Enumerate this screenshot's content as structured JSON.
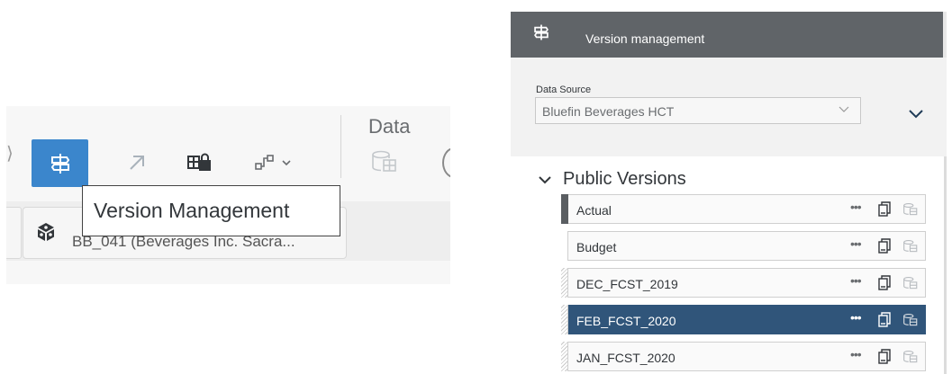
{
  "toolbar": {
    "data_group_label": "Data",
    "buttons": [
      {
        "name": "version-management",
        "icon": "signpost-icon",
        "active": true
      },
      {
        "name": "open-in-new",
        "icon": "arrow-up-right-icon"
      },
      {
        "name": "lock-cells",
        "icon": "table-lock-icon"
      },
      {
        "name": "link-dimensions",
        "icon": "link-icon"
      },
      {
        "name": "data-publish",
        "icon": "database-icon"
      }
    ],
    "tooltip": "Version Management",
    "model_tab": {
      "icon": "cube-icon",
      "label": "BB_041 (Beverages Inc. Sacra..."
    }
  },
  "panel": {
    "title": "Version management",
    "data_source": {
      "label": "Data Source",
      "value": "Bluefin Beverages HCT"
    },
    "public_versions": {
      "title": "Public Versions",
      "items": [
        {
          "name": "Actual",
          "marker": "solid",
          "selected": false
        },
        {
          "name": "Budget",
          "marker": "none",
          "selected": false
        },
        {
          "name": "DEC_FCST_2019",
          "marker": "hatch",
          "selected": false
        },
        {
          "name": "FEB_FCST_2020",
          "marker": "hatch",
          "selected": true
        },
        {
          "name": "JAN_FCST_2020",
          "marker": "hatch",
          "selected": false
        }
      ],
      "more_label": "•••"
    },
    "colors": {
      "header": "#606468",
      "selected_row": "#30557a",
      "active_button": "#3b86cc"
    }
  }
}
